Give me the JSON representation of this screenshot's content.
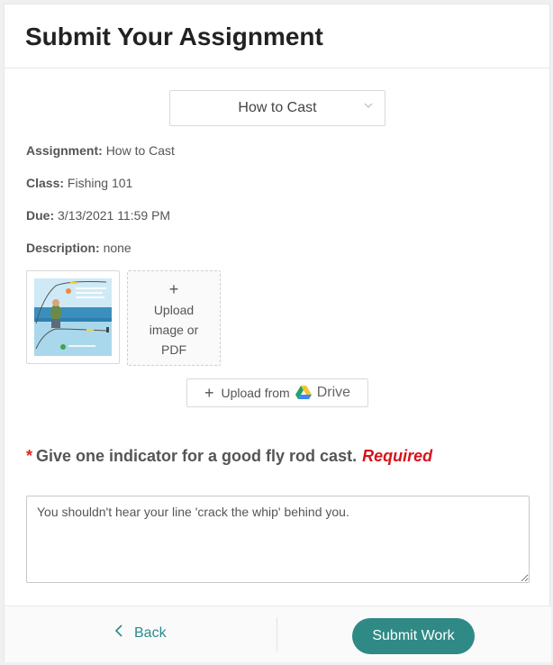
{
  "header": {
    "title": "Submit Your Assignment"
  },
  "assignment_select": {
    "value": "How to Cast"
  },
  "details": {
    "assignment_label": "Assignment:",
    "assignment_value": "How to Cast",
    "class_label": "Class:",
    "class_value": "Fishing 101",
    "due_label": "Due:",
    "due_value": "3/13/2021 11:59 PM",
    "description_label": "Description:",
    "description_value": "none"
  },
  "upload": {
    "plus": "+",
    "line1": "Upload",
    "line2": "image or",
    "line3": "PDF"
  },
  "drive": {
    "label": "Upload from",
    "brand": "Drive"
  },
  "question": {
    "star": "*",
    "text": "Give one indicator for a good fly rod cast.",
    "required": "Required"
  },
  "answer": {
    "value": "You shouldn't hear your line 'crack the whip' behind you."
  },
  "footer": {
    "back_label": "Back",
    "submit_label": "Submit Work"
  },
  "colors": {
    "accent": "#2f8a86",
    "required": "#d4141a"
  }
}
